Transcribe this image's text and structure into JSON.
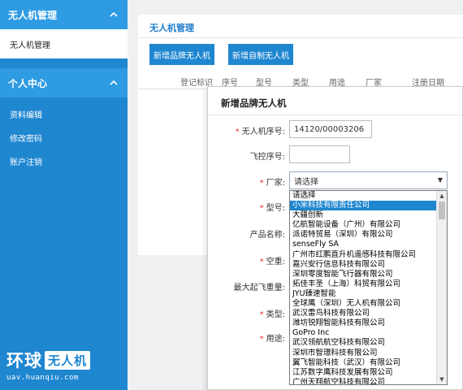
{
  "sidebar": {
    "group1_title": "无人机管理",
    "group1_active": "无人机管理",
    "group2_title": "个人中心",
    "items": [
      "资料编辑",
      "修改密码",
      "账户注销"
    ],
    "chevron": "chevron-up-icon"
  },
  "logo": {
    "part1": "环球",
    "part2": "无人机",
    "url": "uav.huanqiu.com"
  },
  "main": {
    "title": "无人机管理",
    "buttons": {
      "add_brand": "新增品牌无人机",
      "add_diy": "新增自制无人机"
    },
    "columns": [
      "登记标识",
      "序号",
      "型号",
      "类型",
      "用途",
      "厂家",
      "注册日期"
    ]
  },
  "modal": {
    "title": "新增品牌无人机",
    "fields": {
      "serial_label": "无人机序号:",
      "serial_value": "14120/00003206",
      "flight_control_label": "飞控序号:",
      "flight_control_value": "",
      "manufacturer_label": "厂家:",
      "manufacturer_value": "请选择",
      "model_label": "型号:",
      "product_name_label": "产品名称:",
      "empty_weight_label": "空重:",
      "max_takeoff_label": "最大起飞重量:",
      "type_label": "类型:",
      "usage_label": "用途:"
    },
    "manufacturer_options": [
      "请选择",
      "小米科技有限责任公司",
      "大疆创新",
      "亿航智能设备（广州）有限公司",
      "派诺特贸易（深圳）有限公司",
      "senseFly SA",
      "广州市红鹏直升机遥感科技有限公司",
      "嘉兴安行信息科技有限公司",
      "深圳零度智能飞行器有限公司",
      "拓佳丰圣（上海）科贸有限公司",
      "JYU臻速智能",
      "全球鹰（深圳）无人机有限公司",
      "武汉雷鸟科技有限公司",
      "潍坊锐翔智能科技有限公司",
      "GoPro Inc",
      "武汉领航航空科技有限公司",
      "深圳市智璟科技有限公司",
      "翼飞智能科技（武汉）有限公司",
      "江苏数字鹰科技发展有限公司",
      "广州天翔航空科技有限公司"
    ],
    "selected_index": 1
  },
  "colors": {
    "sidebar_bg": "#1f86d0",
    "accent": "#1f86d0",
    "required": "#e03030"
  }
}
